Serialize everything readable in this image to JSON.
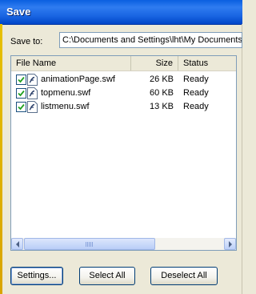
{
  "window": {
    "title": "Save"
  },
  "save_to": {
    "label": "Save to:",
    "path": "C:\\Documents and Settings\\lht\\My Documents"
  },
  "list": {
    "columns": {
      "name": "File Name",
      "size": "Size",
      "status": "Status"
    },
    "files": [
      {
        "name": "animationPage.swf",
        "size": "26 KB",
        "status": "Ready",
        "checked": true
      },
      {
        "name": "topmenu.swf",
        "size": "60 KB",
        "status": "Ready",
        "checked": true
      },
      {
        "name": "listmenu.swf",
        "size": "13 KB",
        "status": "Ready",
        "checked": true
      }
    ],
    "scroll_grip": "III"
  },
  "buttons": {
    "settings": "Settings...",
    "select_all": "Select All",
    "deselect_all": "Deselect All"
  },
  "colors": {
    "title_bar": "#1a66e3",
    "dialog_bg": "#ece9d8",
    "border_blue": "#7f9db9",
    "checkbox_border": "#1c5180"
  },
  "icons": {
    "file": "flash-file-icon",
    "checkbox": "checkbox-checked-icon",
    "scroll_left": "arrow-left-icon",
    "scroll_right": "arrow-right-icon"
  }
}
